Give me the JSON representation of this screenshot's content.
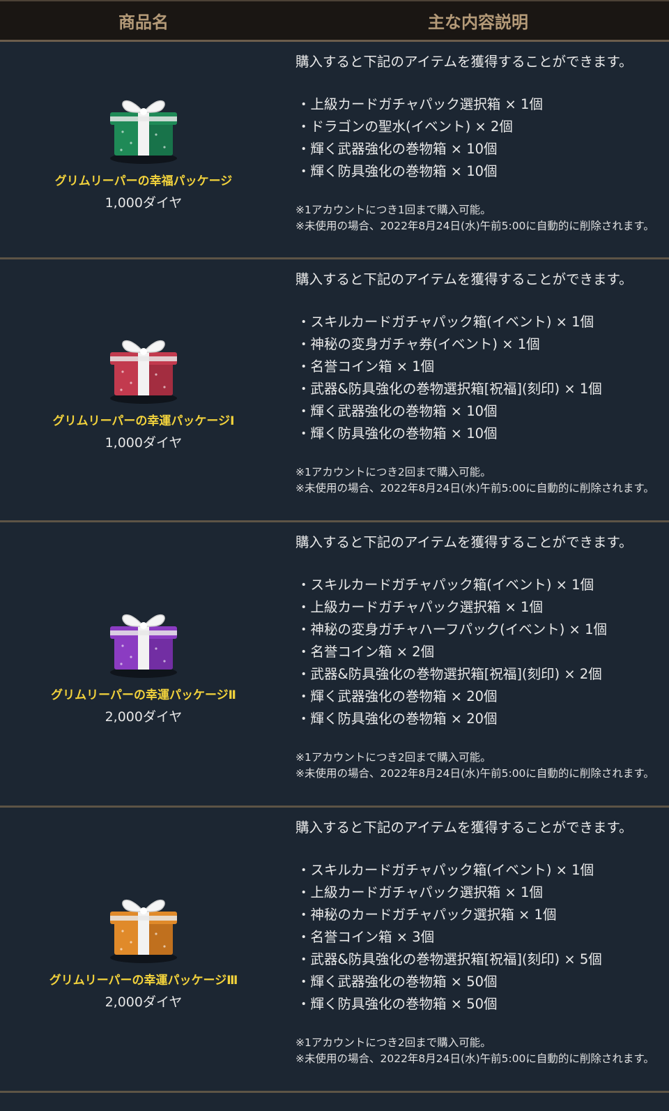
{
  "header": {
    "col_name": "商品名",
    "col_desc": "主な内容説明"
  },
  "packages": [
    {
      "name": "グリムリーパーの幸福パッケージ",
      "price": "1,000ダイヤ",
      "gift_color": "#1f8a57",
      "gift_dark": "#136040",
      "intro": "購入すると下記のアイテムを獲得することができます。",
      "items": [
        "・上級カードガチャパック選択箱 × 1個",
        "・ドラゴンの聖水(イベント) × 2個",
        "・輝く武器強化の巻物箱 × 10個",
        "・輝く防具強化の巻物箱 × 10個"
      ],
      "note1": "※1アカウントにつき1回まで購入可能。",
      "note2": "※未使用の場合、2022年8月24日(水)午前5:00に自動的に削除されます。"
    },
    {
      "name": "グリムリーパーの幸運パッケージⅠ",
      "price": "1,000ダイヤ",
      "gift_color": "#c23a4e",
      "gift_dark": "#8a2234",
      "intro": "購入すると下記のアイテムを獲得することができます。",
      "items": [
        "・スキルカードガチャパック箱(イベント) × 1個",
        "・神秘の変身ガチャ券(イベント) × 1個",
        "・名誉コイン箱 × 1個",
        "・武器&防具強化の巻物選択箱[祝福](刻印) × 1個",
        "・輝く武器強化の巻物箱 × 10個",
        "・輝く防具強化の巻物箱 × 10個"
      ],
      "note1": "※1アカウントにつき2回まで購入可能。",
      "note2": "※未使用の場合、2022年8月24日(水)午前5:00に自動的に削除されます。"
    },
    {
      "name": "グリムリーパーの幸運パッケージⅡ",
      "price": "2,000ダイヤ",
      "gift_color": "#8b3cc2",
      "gift_dark": "#5e238a",
      "intro": "購入すると下記のアイテムを獲得することができます。",
      "items": [
        "・スキルカードガチャパック箱(イベント) × 1個",
        "・上級カードガチャパック選択箱 × 1個",
        "・神秘の変身ガチャハーフパック(イベント) × 1個",
        "・名誉コイン箱 × 2個",
        "・武器&防具強化の巻物選択箱[祝福](刻印) × 2個",
        "・輝く武器強化の巻物箱 × 20個",
        "・輝く防具強化の巻物箱 × 20個"
      ],
      "note1": "※1アカウントにつき2回まで購入可能。",
      "note2": "※未使用の場合、2022年8月24日(水)午前5:00に自動的に削除されます。"
    },
    {
      "name": "グリムリーパーの幸運パッケージⅢ",
      "price": "2,000ダイヤ",
      "gift_color": "#e08a2a",
      "gift_dark": "#a65b14",
      "intro": "購入すると下記のアイテムを獲得することができます。",
      "items": [
        "・スキルカードガチャパック箱(イベント) × 1個",
        "・上級カードガチャパック選択箱 × 1個",
        "・神秘のカードガチャパック選択箱 × 1個",
        "・名誉コイン箱 × 3個",
        "・武器&防具強化の巻物選択箱[祝福](刻印) × 5個",
        "・輝く武器強化の巻物箱 × 50個",
        "・輝く防具強化の巻物箱 × 50個"
      ],
      "note1": "※1アカウントにつき2回まで購入可能。",
      "note2": "※未使用の場合、2022年8月24日(水)午前5:00に自動的に削除されます。"
    }
  ]
}
